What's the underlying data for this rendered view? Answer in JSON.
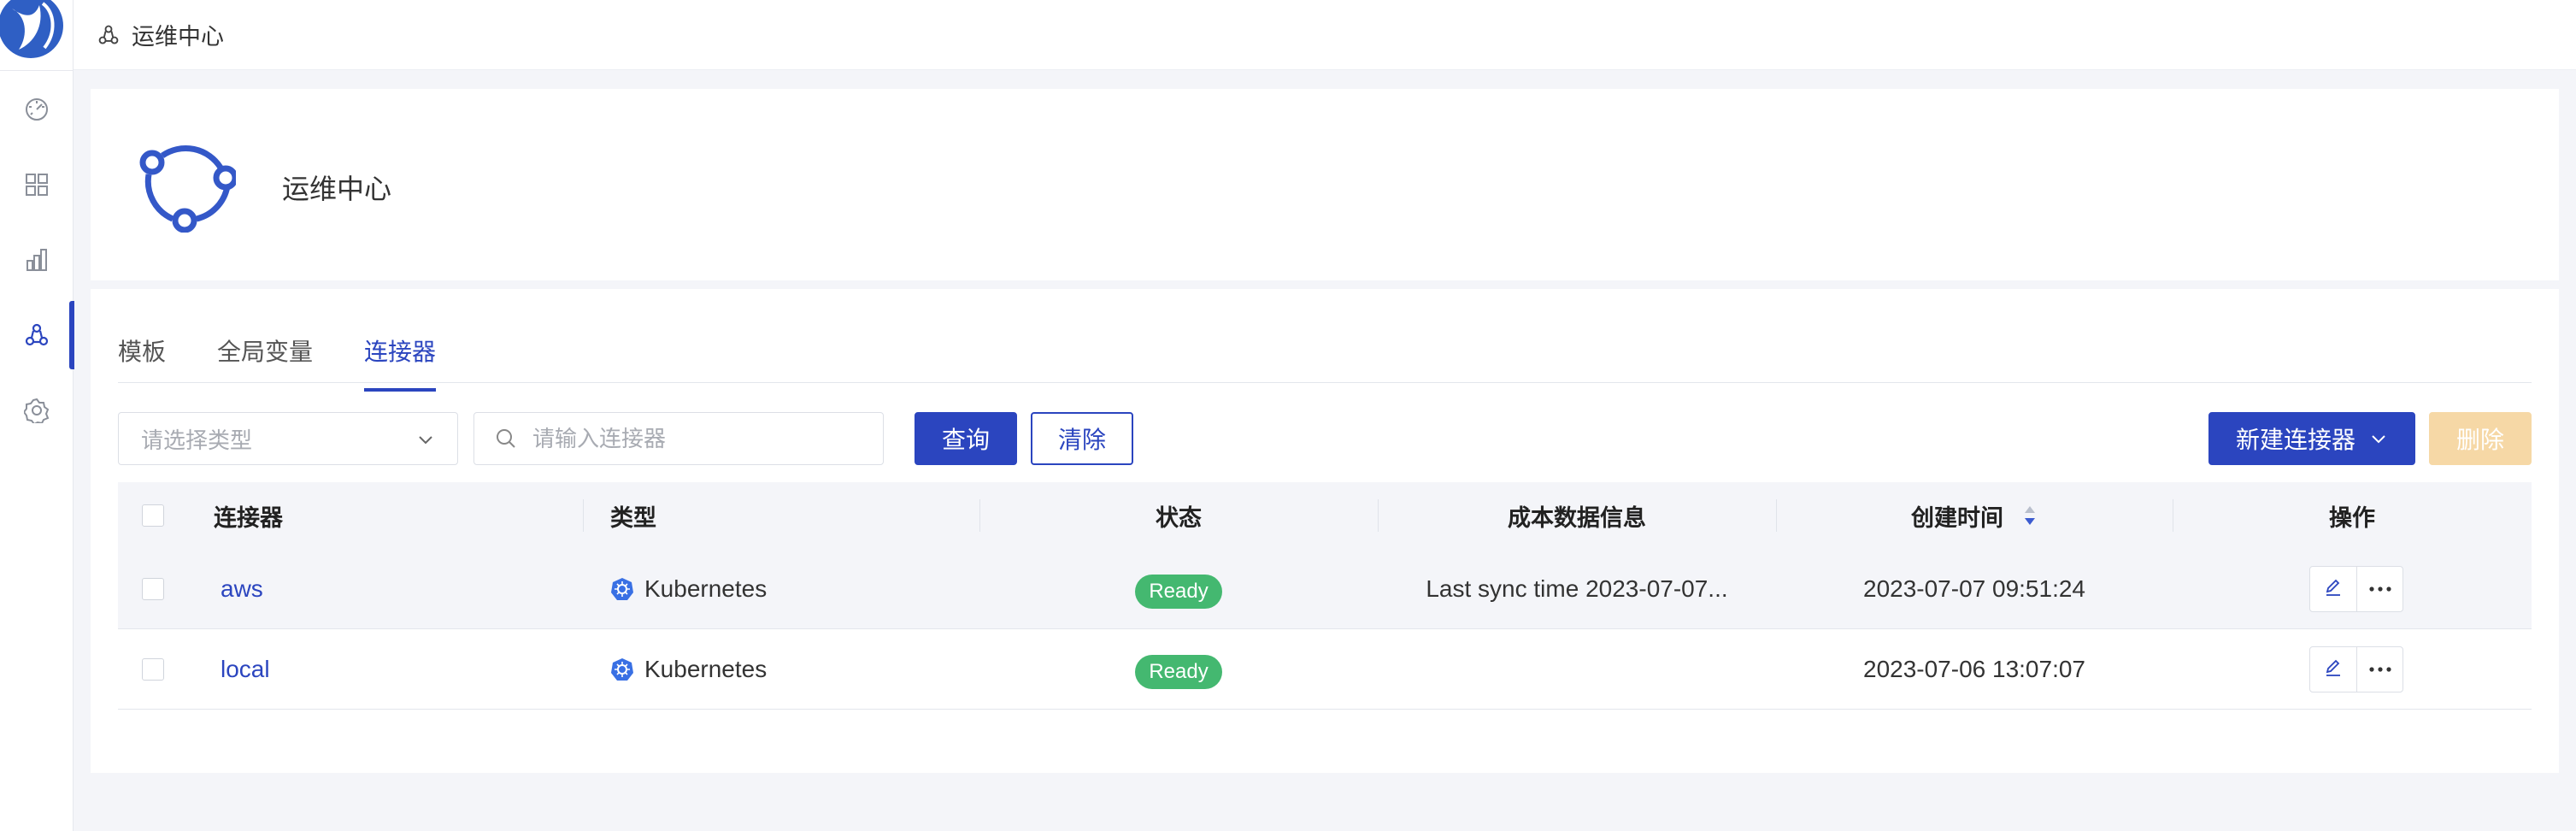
{
  "topbar": {
    "breadcrumb": "运维中心"
  },
  "header": {
    "title": "运维中心"
  },
  "tabs": [
    {
      "label": "模板",
      "active": false
    },
    {
      "label": "全局变量",
      "active": false
    },
    {
      "label": "连接器",
      "active": true
    }
  ],
  "toolbar": {
    "type_select_placeholder": "请选择类型",
    "search_placeholder": "请输入连接器",
    "search_value": "",
    "query_label": "查询",
    "clear_label": "清除",
    "new_label": "新建连接器",
    "delete_label": "删除"
  },
  "table": {
    "columns": [
      "连接器",
      "类型",
      "状态",
      "成本数据信息",
      "创建时间",
      "操作"
    ],
    "rows": [
      {
        "name": "aws",
        "type": "Kubernetes",
        "status": "Ready",
        "cost_info": "Last sync time 2023-07-07...",
        "created": "2023-07-07 09:51:24"
      },
      {
        "name": "local",
        "type": "Kubernetes",
        "status": "Ready",
        "cost_info": "",
        "created": "2023-07-06 13:07:07"
      }
    ]
  },
  "sidebar": {
    "items": [
      {
        "icon": "dashboard-icon",
        "active": false
      },
      {
        "icon": "apps-grid-icon",
        "active": false
      },
      {
        "icon": "bar-chart-icon",
        "active": false
      },
      {
        "icon": "ops-center-icon",
        "active": true
      },
      {
        "icon": "settings-gear-icon",
        "active": false
      }
    ]
  },
  "colors": {
    "primary": "#2b45bf",
    "ready_badge": "#44b870",
    "delete_disabled": "#f6d8a6",
    "background": "#f4f5f9"
  }
}
